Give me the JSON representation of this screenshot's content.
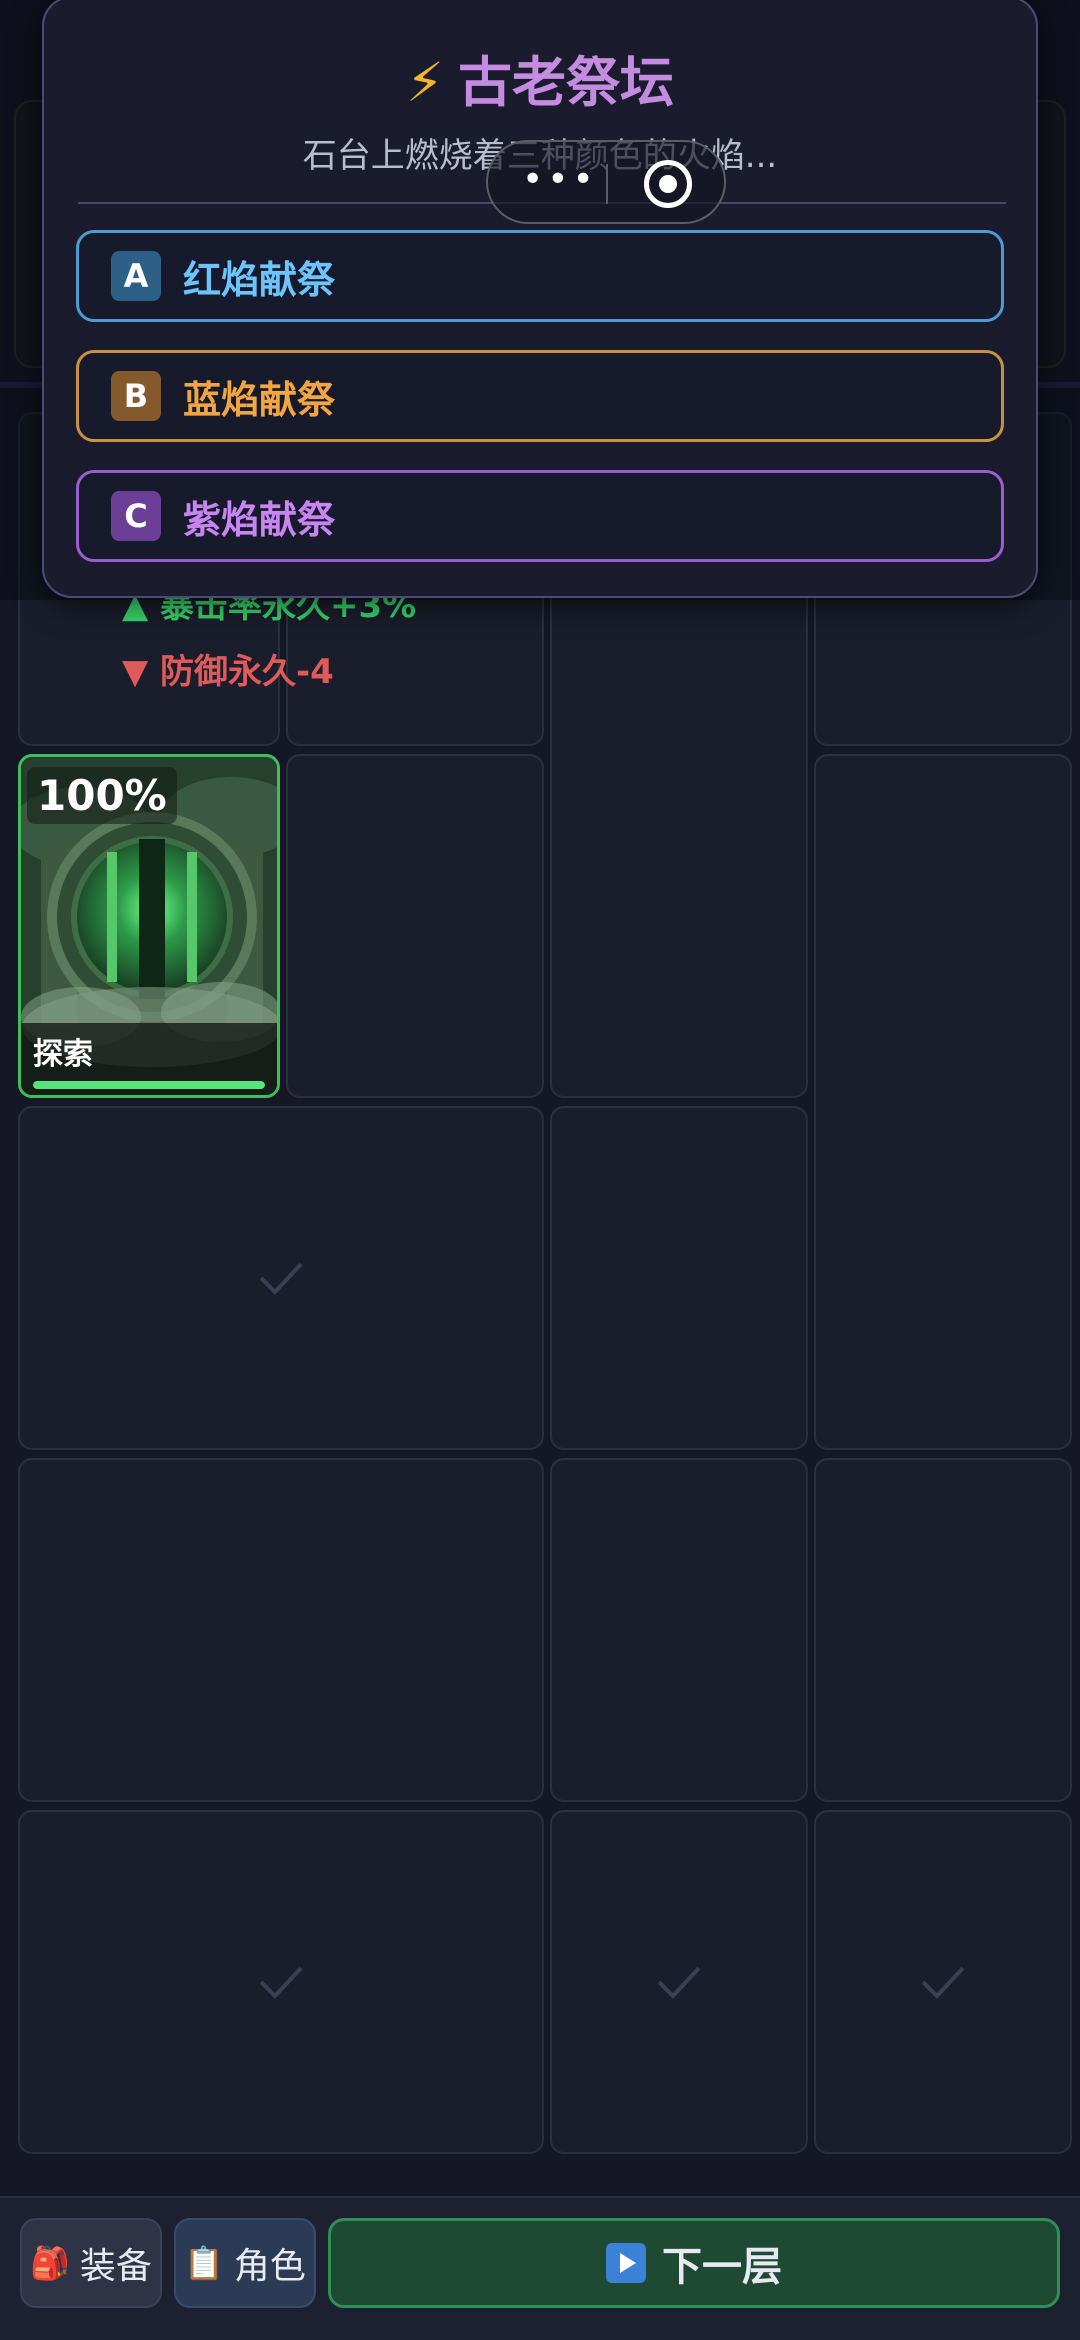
{
  "modal": {
    "title": "古老祭坛",
    "icon": "lightning-bolt-icon",
    "subtitle": "石台上燃烧着三种颜色的火焰...",
    "options": [
      {
        "key": "A",
        "label": "红焰献祭",
        "color": "#4f9bd0"
      },
      {
        "key": "B",
        "label": "蓝焰献祭",
        "color": "#c99045"
      },
      {
        "key": "C",
        "label": "紫焰献祭",
        "color": "#9a5ed0"
      }
    ]
  },
  "effects": [
    {
      "label": "暴击率永久+3%",
      "direction": "up"
    },
    {
      "label": "防御永久-4",
      "direction": "down"
    }
  ],
  "card": {
    "percent": "100%",
    "label": "探索",
    "progress": 1.0
  },
  "bottom": {
    "equip_label": "装备",
    "equip_icon": "backpack-icon",
    "char_label": "角色",
    "char_icon": "clipboard-icon",
    "next_label": "下一层",
    "next_icon": "play-icon"
  }
}
